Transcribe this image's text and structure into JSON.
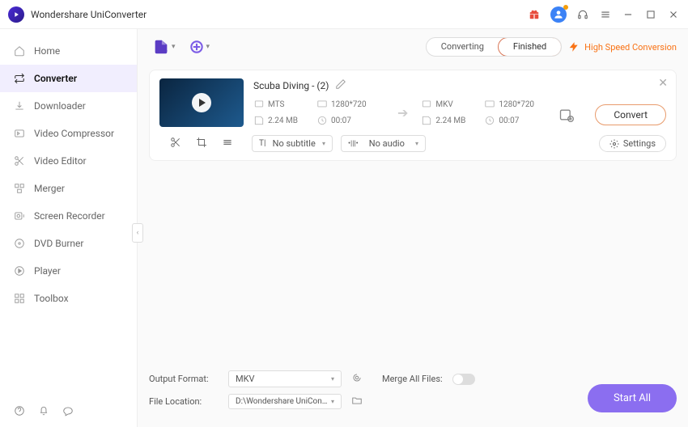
{
  "app": {
    "title": "Wondershare UniConverter"
  },
  "sidebar": {
    "items": [
      {
        "label": "Home"
      },
      {
        "label": "Converter"
      },
      {
        "label": "Downloader"
      },
      {
        "label": "Video Compressor"
      },
      {
        "label": "Video Editor"
      },
      {
        "label": "Merger"
      },
      {
        "label": "Screen Recorder"
      },
      {
        "label": "DVD Burner"
      },
      {
        "label": "Player"
      },
      {
        "label": "Toolbox"
      }
    ]
  },
  "tabs": {
    "converting": "Converting",
    "finished": "Finished",
    "active": "finished"
  },
  "highspeed_label": "High Speed Conversion",
  "file": {
    "title": "Scuba Diving - (2)",
    "src": {
      "format": "MTS",
      "resolution": "1280*720",
      "size": "2.24 MB",
      "duration": "00:07"
    },
    "dst": {
      "format": "MKV",
      "resolution": "1280*720",
      "size": "2.24 MB",
      "duration": "00:07"
    },
    "subtitle_label": "No subtitle",
    "audio_label": "No audio",
    "settings_label": "Settings",
    "convert_label": "Convert"
  },
  "bottom": {
    "output_format_label": "Output Format:",
    "output_format_value": "MKV",
    "file_location_label": "File Location:",
    "file_location_value": "D:\\Wondershare UniConverter",
    "merge_label": "Merge All Files:",
    "start_all": "Start All"
  }
}
